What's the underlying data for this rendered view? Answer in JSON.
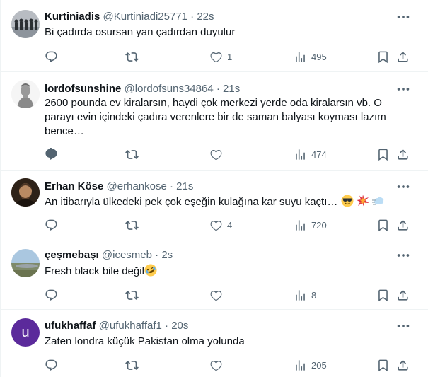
{
  "tweets": [
    {
      "name": "Kurtiniadis",
      "handle": "@Kurtiniadi25771",
      "time": "22s",
      "text": "Bi çadırda osursan yan çadırdan duyulur",
      "replies": "",
      "reposts": "",
      "likes": "1",
      "views": "495",
      "avatar": "group-photo"
    },
    {
      "name": "lordofsunshine",
      "handle": "@lordofsuns34864",
      "time": "21s",
      "text": "2600 pounda ev kiralarsın, haydi çok merkezi yerde oda kiralarsın vb. O parayı evin içindeki çadıra verenlere bir de saman balyası koyması lazım bence…",
      "replies": "",
      "reposts": "",
      "likes": "",
      "views": "474",
      "avatar": "statue-bust"
    },
    {
      "name": "Erhan Köse",
      "handle": "@erhankose",
      "time": "21s",
      "text": "An itibarıyla ülkedeki pek çok eşeğin kulağına kar suyu kaçtı…",
      "text_emojis": [
        "sunglasses-emoji",
        "collision-emoji",
        "dash-emoji"
      ],
      "replies": "",
      "reposts": "",
      "likes": "4",
      "views": "720",
      "avatar": "man-portrait"
    },
    {
      "name": "çeşmebaşı",
      "handle": "@icesmeb",
      "time": "2s",
      "text": "Fresh black bile değil",
      "text_emojis": [
        "rofl-emoji"
      ],
      "replies": "",
      "reposts": "",
      "likes": "",
      "views": "8",
      "avatar": "landscape-photo"
    },
    {
      "name": "ufukhaffaf",
      "handle": "@ufukhaffaf1",
      "time": "20s",
      "text": "Zaten londra küçük Pakistan olma yolunda",
      "replies": "",
      "reposts": "",
      "likes": "",
      "views": "205",
      "avatar": "letter-avatar",
      "avatar_letter": "u",
      "avatar_color": "#5b2a9b"
    }
  ],
  "separator": "·",
  "colors": {
    "text": "#0f1419",
    "secondary": "#536471",
    "border": "#eff3f4"
  }
}
